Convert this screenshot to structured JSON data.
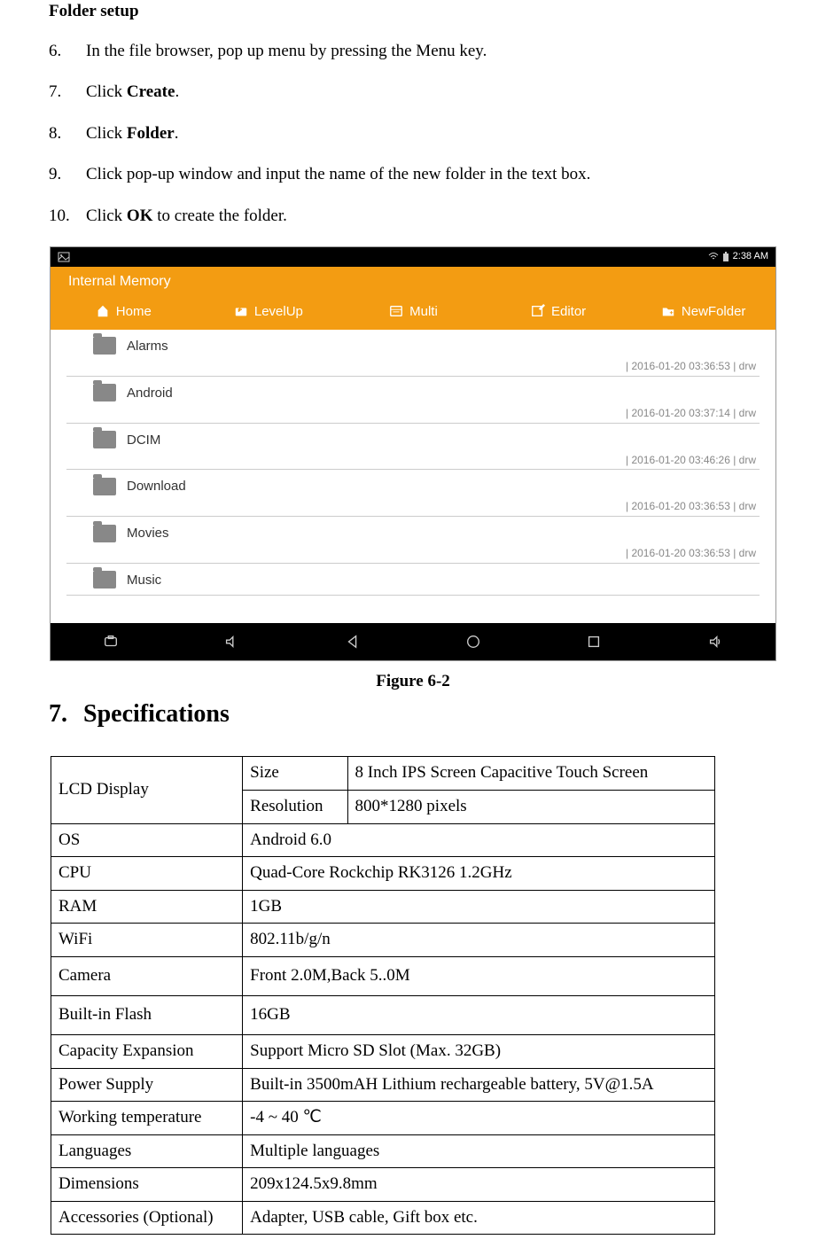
{
  "folder_setup": {
    "title": "Folder setup",
    "steps": [
      {
        "num": "6.",
        "parts": [
          "In the file browser, pop up menu by pressing the Menu key."
        ]
      },
      {
        "num": "7.",
        "parts": [
          "Click ",
          {
            "b": "Create"
          },
          "."
        ]
      },
      {
        "num": "8.",
        "parts": [
          "Click ",
          {
            "b": "Folder"
          },
          "."
        ]
      },
      {
        "num": "9.",
        "parts": [
          "Click pop-up window and input the name of the new folder in the text box."
        ]
      },
      {
        "num": "10.",
        "parts": [
          "Click ",
          {
            "b": "OK"
          },
          " to create the folder."
        ]
      }
    ]
  },
  "screenshot": {
    "status_time": "2:38 AM",
    "header_title": "Internal Memory",
    "toolbar": [
      {
        "icon": "home",
        "label": "Home"
      },
      {
        "icon": "levelup",
        "label": "LevelUp"
      },
      {
        "icon": "multi",
        "label": "Multi"
      },
      {
        "icon": "editor",
        "label": "Editor"
      },
      {
        "icon": "newfolder",
        "label": "NewFolder"
      }
    ],
    "files": [
      {
        "name": "Alarms",
        "meta": "| 2016-01-20 03:36:53 | drw"
      },
      {
        "name": "Android",
        "meta": "| 2016-01-20 03:37:14 | drw"
      },
      {
        "name": "DCIM",
        "meta": "| 2016-01-20 03:46:26 | drw"
      },
      {
        "name": "Download",
        "meta": "| 2016-01-20 03:36:53 | drw"
      },
      {
        "name": "Movies",
        "meta": "| 2016-01-20 03:36:53 | drw"
      },
      {
        "name": "Music",
        "meta": ""
      }
    ]
  },
  "figure_caption": "Figure 6-2",
  "specifications": {
    "num": "7.",
    "title": "Specifications",
    "rows": [
      {
        "c": [
          "LCD Display",
          "Size",
          "8 Inch IPS Screen Capacitive Touch Screen"
        ],
        "rs": [
          2,
          1,
          1
        ]
      },
      {
        "c": [
          "Resolution",
          "800*1280 pixels"
        ]
      },
      {
        "c": [
          "OS",
          "Android 6.0"
        ],
        "cs": [
          1,
          2
        ]
      },
      {
        "c": [
          "CPU",
          "Quad-Core Rockchip RK3126 1.2GHz"
        ],
        "cs": [
          1,
          2
        ]
      },
      {
        "c": [
          "RAM",
          "1GB"
        ],
        "cs": [
          1,
          2
        ]
      },
      {
        "c": [
          "WiFi",
          "802.11b/g/n"
        ],
        "cs": [
          1,
          2
        ]
      },
      {
        "c": [
          "Camera",
          "Front 2.0M,Back 5..0M"
        ],
        "cs": [
          1,
          2
        ],
        "tall": true
      },
      {
        "c": [
          "Built-in Flash",
          "16GB"
        ],
        "cs": [
          1,
          2
        ],
        "tall": true
      },
      {
        "c": [
          "Capacity Expansion",
          "Support Micro SD Slot (Max. 32GB)"
        ],
        "cs": [
          1,
          2
        ]
      },
      {
        "c": [
          "Power Supply",
          "Built-in 3500mAH Lithium rechargeable battery, 5V@1.5A"
        ],
        "cs": [
          1,
          2
        ]
      },
      {
        "c": [
          "Working temperature",
          "-4 ~ 40    ℃"
        ],
        "cs": [
          1,
          2
        ]
      },
      {
        "c": [
          "Languages",
          "Multiple languages"
        ],
        "cs": [
          1,
          2
        ]
      },
      {
        "c": [
          "Dimensions",
          "209x124.5x9.8mm"
        ],
        "cs": [
          1,
          2
        ]
      },
      {
        "c": [
          "Accessories (Optional)",
          "Adapter, USB cable, Gift box etc."
        ],
        "cs": [
          1,
          2
        ]
      }
    ]
  }
}
